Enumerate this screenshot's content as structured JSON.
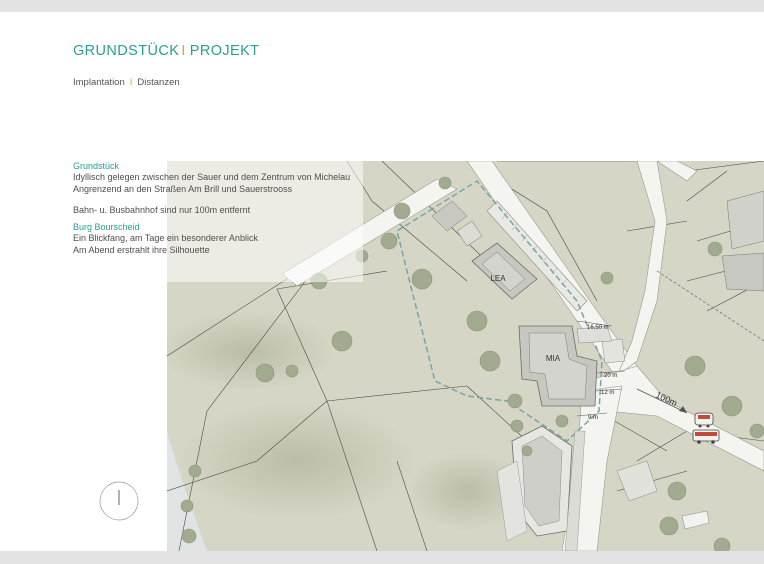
{
  "header": {
    "title_left": "GRUNDSTÜCK",
    "title_sep": "I",
    "title_right": "PROJEKT"
  },
  "subnav": {
    "item1": "Implantation",
    "sep": "I",
    "item2": "Distanzen"
  },
  "info": {
    "heading1": "Grundstück",
    "line1": "Idyllisch gelegen zwischen der Sauer und dem Zentrum von Michelau",
    "line2": "Angrenzend an den Straßen Am Brill und Sauerstrooss",
    "line3": "Bahn- u. Busbahnhof sind nur 100m entfernt",
    "heading2": "Burg Bourscheid",
    "line4": "Ein Blickfang, am Tage ein besonderer Anblick",
    "line5": "Am Abend erstrahlt ihre Silhouette"
  },
  "map": {
    "building1": "LEA",
    "building2": "MIA",
    "dist1": "16,50 m",
    "dist2": "20 m",
    "dist3": "12 m",
    "dist4": "9 m",
    "dist_station": "100m",
    "colors": {
      "ground": "#d6d6c6",
      "road": "#f4f4f0",
      "plot_outline": "#7aa5a7",
      "building": "#cfcfcb",
      "water": "#e0e4e4"
    }
  },
  "icons": [
    "north-compass-icon",
    "train-icon",
    "bus-icon"
  ]
}
